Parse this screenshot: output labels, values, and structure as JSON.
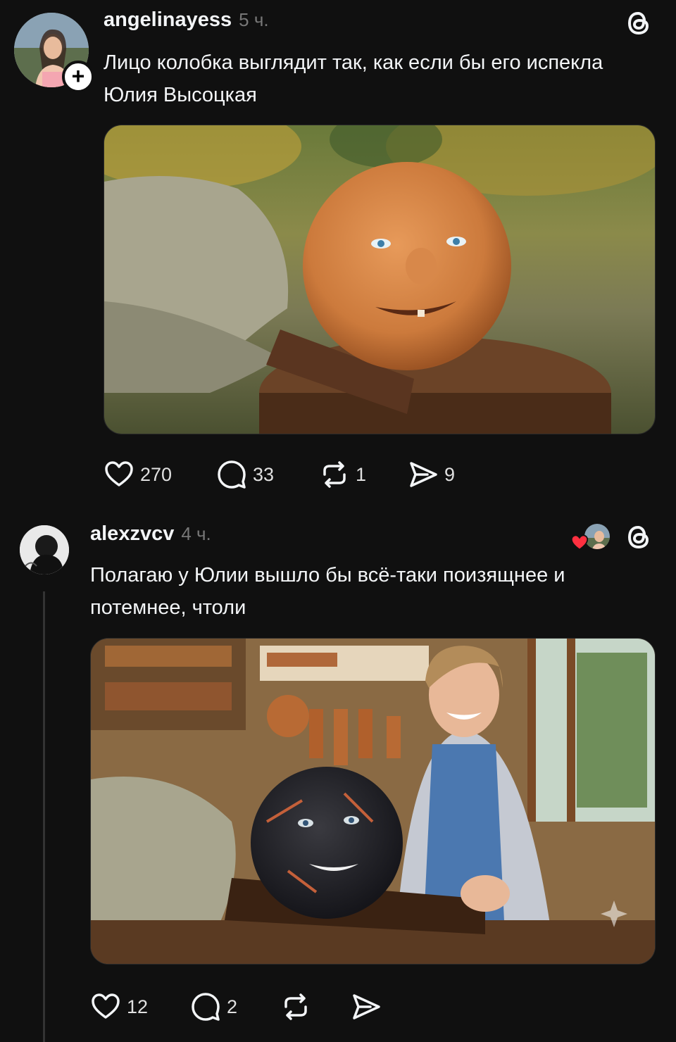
{
  "posts": [
    {
      "username": "angelinayess",
      "time": "5 ч.",
      "text": "Лицо колобка выглядит так, как если бы его испекла Юлия Высоцкая",
      "likes": "270",
      "comments": "33",
      "reposts": "1",
      "shares": "9",
      "avatar_icon": "user-avatar",
      "follow_icon": "plus-icon"
    },
    {
      "username": "alexzvcv",
      "time": "4 ч.",
      "text": "Полагаю у Юлии вышло бы всё-таки поизящнее и потемнее, чтоли",
      "likes": "12",
      "comments": "2",
      "reposts": "",
      "shares": ""
    }
  ],
  "icons": {
    "app_logo": "threads-logo-icon",
    "like": "heart-icon",
    "comment": "comment-icon",
    "repost": "repost-icon",
    "share": "send-icon"
  },
  "colors": {
    "background": "#101010",
    "text": "#f3f5f7",
    "muted": "#777777",
    "liked_heart": "#ff3040"
  }
}
